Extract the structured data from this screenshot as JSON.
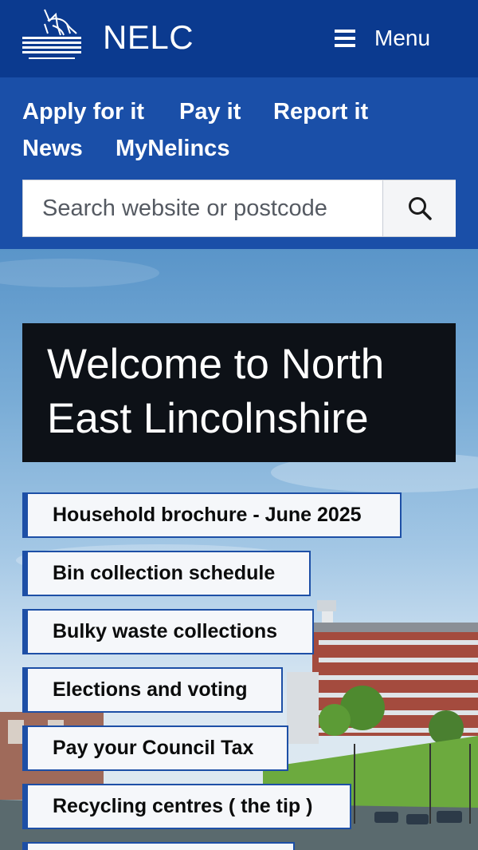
{
  "header": {
    "site_name": "NELC",
    "menu_label": "Menu"
  },
  "nav": {
    "links": [
      "Apply for it",
      "Pay it",
      "Report it",
      "News",
      "MyNelincs"
    ]
  },
  "search": {
    "placeholder": "Search website or postcode"
  },
  "hero": {
    "welcome_title": "Welcome to North East Lincolnshire"
  },
  "quick_links": [
    "Household brochure - June 2025",
    "Bin collection schedule",
    "Bulky waste collections",
    "Elections and voting",
    "Pay your Council Tax",
    "Recycling centres ( the tip )"
  ],
  "colors": {
    "header_bg": "#0b3a8f",
    "nav_bg": "#1a4fa8",
    "link_border": "#1d4fa6",
    "welcome_bg": "#0d1117"
  }
}
